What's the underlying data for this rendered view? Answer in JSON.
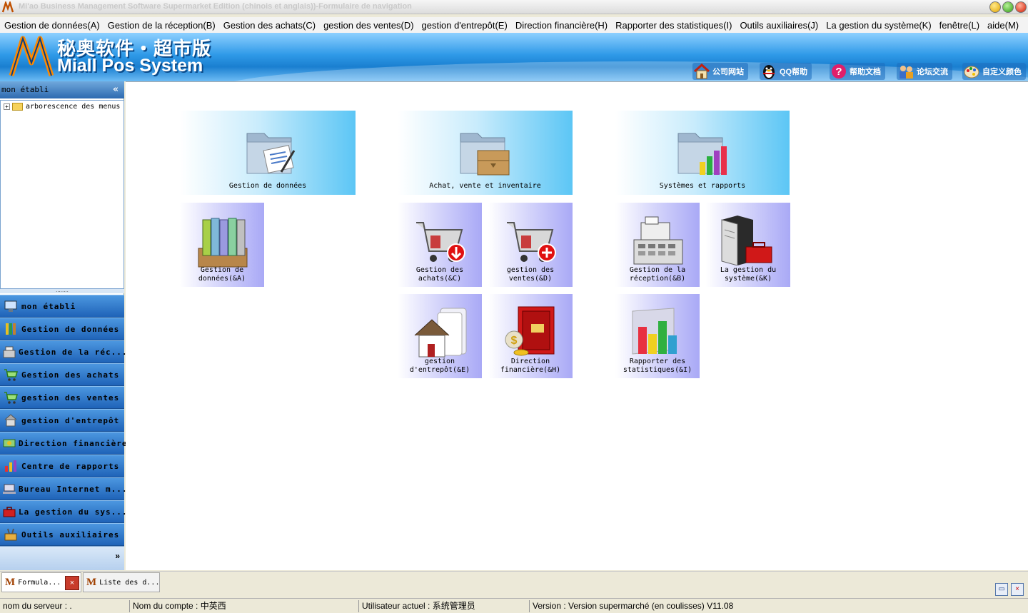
{
  "window": {
    "title": "Mi'ao Business Management Software Supermarket Edition (chinois et anglais))-Formulaire de navigation",
    "logo_icon": "mi-logo-icon"
  },
  "menubar": [
    "Gestion de données(A)",
    "Gestion de la réception(B)",
    "Gestion des achats(C)",
    "gestion des ventes(D)",
    "gestion d'entrepôt(E)",
    "Direction financière(H)",
    "Rapporter des statistiques(I)",
    "Outils auxiliaires(J)",
    "La gestion du système(K)",
    "fenêtre(L)",
    "aide(M)"
  ],
  "banner": {
    "cn_title": "秘奥软件・超市版",
    "en_title": "Miall Pos System",
    "quick_links": [
      {
        "label": "公司网站",
        "icon": "home-icon"
      },
      {
        "label": "QQ帮助",
        "icon": "qq-penguin-icon"
      },
      {
        "label": "帮助文档",
        "icon": "help-doc-icon"
      },
      {
        "label": "论坛交流",
        "icon": "forum-icon"
      },
      {
        "label": "自定义颜色",
        "icon": "palette-icon"
      }
    ]
  },
  "left_panel": {
    "header": "mon établi",
    "collapse_glyph": "«",
    "tree_root": "arborescence des menus",
    "nav_items": [
      {
        "label": "mon établi",
        "icon": "workbench-icon"
      },
      {
        "label": "Gestion de données",
        "icon": "binders-icon"
      },
      {
        "label": "Gestion de la réc...",
        "icon": "cash-register-icon"
      },
      {
        "label": "Gestion des achats",
        "icon": "cart-icon"
      },
      {
        "label": "gestion des ventes",
        "icon": "cart-icon"
      },
      {
        "label": "gestion d'entrepôt",
        "icon": "warehouse-icon"
      },
      {
        "label": "Direction financière",
        "icon": "money-icon"
      },
      {
        "label": "Centre de rapports",
        "icon": "bar-chart-icon"
      },
      {
        "label": "Bureau Internet m...",
        "icon": "network-icon"
      },
      {
        "label": "La gestion du sys...",
        "icon": "toolbox-icon"
      },
      {
        "label": "Outils auxiliaires",
        "icon": "tools-icon"
      }
    ],
    "more_glyph": "»"
  },
  "main": {
    "groups": [
      {
        "label": "Gestion de données",
        "icon": "folder-document-icon"
      },
      {
        "label": "Achat, vente et inventaire",
        "icon": "folder-box-icon"
      },
      {
        "label": "Systèmes et rapports",
        "icon": "folder-chart-icon"
      }
    ],
    "modules": [
      {
        "label": "Gestion de données(&A)",
        "icon": "binders-icon"
      },
      {
        "label": "Gestion des achats(&C)",
        "icon": "cart-download-icon"
      },
      {
        "label": "gestion des ventes(&D)",
        "icon": "cart-add-icon"
      },
      {
        "label": "Gestion de la réception(&B)",
        "icon": "cash-register-icon"
      },
      {
        "label": "La gestion du système(&K)",
        "icon": "server-toolbox-icon"
      },
      {
        "label": "gestion d'entrepôt(&E)",
        "icon": "warehouse-house-icon"
      },
      {
        "label": "Direction financière(&H)",
        "icon": "safe-money-icon"
      },
      {
        "label": "Rapporter des statistiques(&I)",
        "icon": "bar-chart-icon"
      }
    ]
  },
  "tabs": [
    {
      "label": "Formula...",
      "active": true
    },
    {
      "label": "Liste des d...",
      "active": false
    }
  ],
  "tab_close_glyph": "×",
  "statusbar": {
    "server": "nom du serveur : .",
    "account": "Nom du compte : 中英西",
    "user": "Utilisateur actuel : 系统管理员",
    "version": "Version : Version supermarché (en coulisses) V11.08"
  }
}
